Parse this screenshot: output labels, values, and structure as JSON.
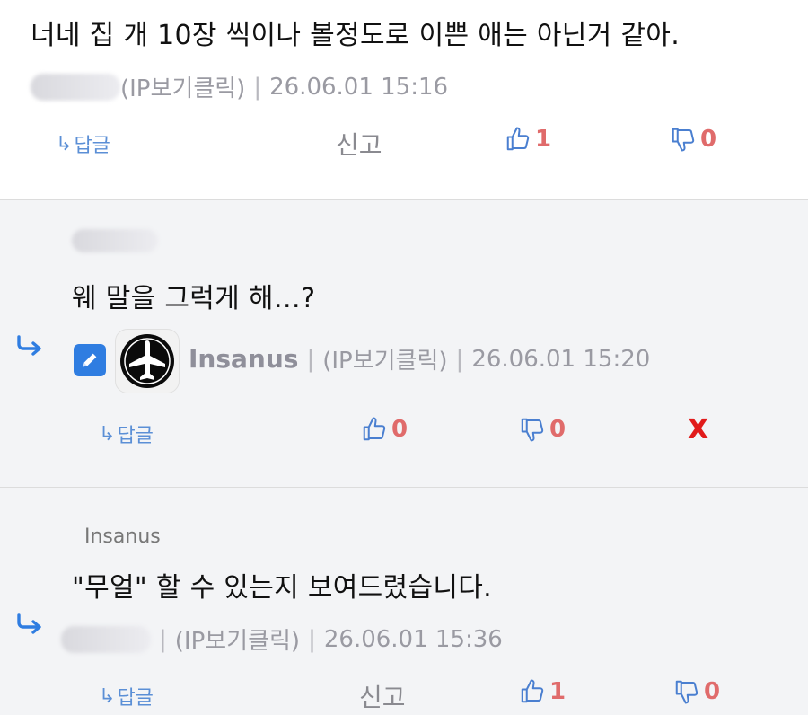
{
  "comments": [
    {
      "text": "너네 집 개 10장 씩이나 볼정도로 이쁜 애는 아닌거 같아.",
      "ip_label": "(IP보기클릭)",
      "timestamp": "26.06.01 15:16",
      "actions": {
        "reply": "답글",
        "report": "신고",
        "likes": "1",
        "dislikes": "0"
      }
    },
    {
      "text": "웨 말을 그럭게 해…?",
      "author": "Insanus",
      "ip_label": "(IP보기클릭)",
      "timestamp": "26.06.01 15:20",
      "actions": {
        "reply": "답글",
        "likes": "0",
        "dislikes": "0",
        "delete": "X"
      }
    },
    {
      "mention": "Insanus",
      "text": "\"무얼\" 할 수 있는지 보여드렸습니다.",
      "ip_label": "(IP보기클릭)",
      "timestamp": "26.06.01 15:36",
      "actions": {
        "reply": "답글",
        "report": "신고",
        "likes": "1",
        "dislikes": "0"
      }
    }
  ],
  "icons": {
    "reply_arrow": "reply-arrow-icon",
    "thumbs_up": "thumbs-up-icon",
    "thumbs_down": "thumbs-down-icon",
    "edit": "pencil-icon",
    "avatar": "airplane-icon"
  },
  "colors": {
    "accent_blue": "#2f7de1",
    "like_red": "#e06b6b",
    "delete_red": "#e11b1b",
    "meta_gray": "#9a9aa2"
  }
}
